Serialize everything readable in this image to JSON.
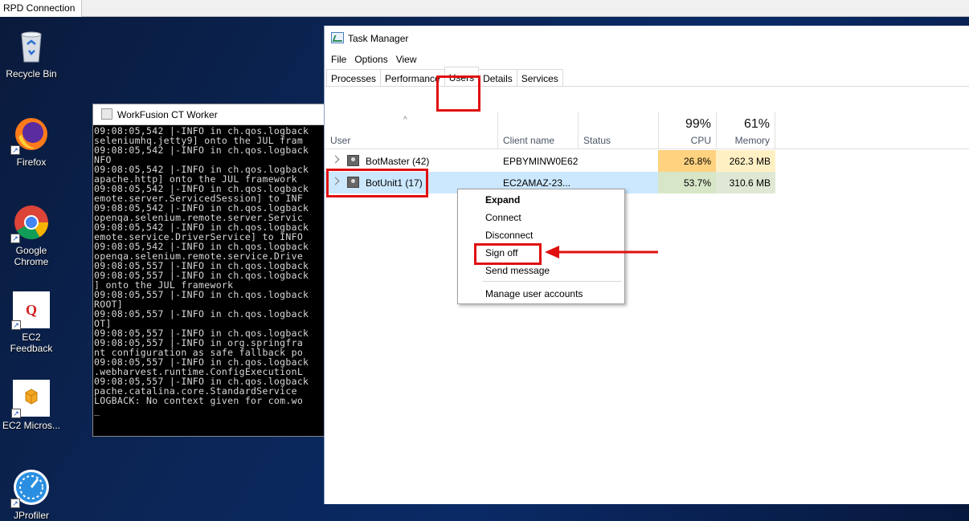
{
  "rdp": {
    "tab_label": "RPD Connection"
  },
  "desktop_icons": [
    {
      "label": "Recycle Bin"
    },
    {
      "label": "Firefox"
    },
    {
      "label": "Google Chrome"
    },
    {
      "label": "EC2 Feedback"
    },
    {
      "label": "EC2 Micros..."
    },
    {
      "label": "JProfiler"
    }
  ],
  "console": {
    "title": "WorkFusion CT Worker",
    "lines": [
      "09:08:05,542 |-INFO in ch.qos.logback",
      "seleniumhq.jetty9] onto the JUL fram",
      "09:08:05,542 |-INFO in ch.qos.logback",
      "NFO",
      "09:08:05,542 |-INFO in ch.qos.logback",
      "apache.http] onto the JUL framework",
      "09:08:05,542 |-INFO in ch.qos.logback",
      "emote.server.ServicedSession] to INF",
      "09:08:05,542 |-INFO in ch.qos.logback",
      "openqa.selenium.remote.server.Servic",
      "09:08:05,542 |-INFO in ch.qos.logback",
      "emote.service.DriverService] to INFO",
      "09:08:05,542 |-INFO in ch.qos.logback",
      "openqa.selenium.remote.service.Drive",
      "09:08:05,557 |-INFO in ch.qos.logback",
      "09:08:05,557 |-INFO in ch.qos.logback",
      "] onto the JUL framework",
      "09:08:05,557 |-INFO in ch.qos.logback",
      "ROOT]",
      "09:08:05,557 |-INFO in ch.qos.logback",
      "OT]",
      "09:08:05,557 |-INFO in ch.qos.logback",
      "09:08:05,557 |-INFO in org.springfra",
      "nt configuration as safe fallback po",
      "09:08:05,557 |-INFO in ch.qos.logback",
      ".webharvest.runtime.ConfigExecutionL",
      "09:08:05,557 |-INFO in ch.qos.logback",
      "pache.catalina.core.StandardService",
      "LOGBACK: No context given for com.wo",
      "_"
    ]
  },
  "task_manager": {
    "title": "Task Manager",
    "menu": [
      "File",
      "Options",
      "View"
    ],
    "tabs": [
      "Processes",
      "Performance",
      "Users",
      "Details",
      "Services"
    ],
    "active_tab": "Users",
    "columns": {
      "user": "User",
      "client_name": "Client name",
      "status": "Status",
      "cpu_total": "99%",
      "cpu": "CPU",
      "memory_total": "61%",
      "memory": "Memory"
    },
    "rows": [
      {
        "user": "BotMaster (42)",
        "client": "EPBYMINW0E62",
        "status": "",
        "cpu": "26.8%",
        "memory": "262.3 MB"
      },
      {
        "user": "BotUnit1 (17)",
        "client": "EC2AMAZ-23...",
        "status": "",
        "cpu": "53.7%",
        "memory": "310.6 MB"
      }
    ]
  },
  "context_menu": {
    "items": [
      "Expand",
      "Connect",
      "Disconnect",
      "Sign off",
      "Send message",
      "Manage user accounts"
    ]
  },
  "colors": {
    "highlight": "#e01010",
    "selected_row": "#cce8ff",
    "cpu_heat_1": "#ffd27f",
    "cpu_heat_2": "#ffe6a8",
    "mem_heat": "#fff0c4"
  }
}
